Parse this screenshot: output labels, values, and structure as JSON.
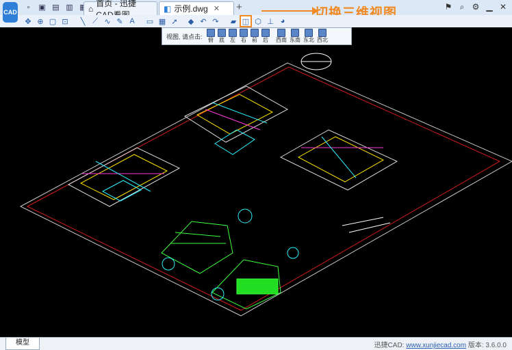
{
  "app": {
    "logo_text": "CAD"
  },
  "quick_access": {
    "icons": [
      "new-icon",
      "open-icon",
      "save-icon",
      "print-icon",
      "copy-icon"
    ]
  },
  "tabs": [
    {
      "label": "首页 - 迅捷CAD看图",
      "active": false
    },
    {
      "label": "示例.dwg",
      "active": true
    }
  ],
  "new_tab_label": "+",
  "callout": {
    "text": "切换三维视图"
  },
  "view_panel": {
    "label": "视图, 请点击:",
    "buttons": [
      "俯",
      "底",
      "左",
      "右",
      "前",
      "后",
      "西南",
      "东南",
      "东北",
      "西北"
    ]
  },
  "status": {
    "model_tab": "模型",
    "product": "迅捷CAD:",
    "url": "www.xunjiecad.com",
    "version_label": "版本:",
    "version": "3.6.0.0"
  },
  "colors": {
    "accent": "#f08a24",
    "canvas": "#000000"
  }
}
